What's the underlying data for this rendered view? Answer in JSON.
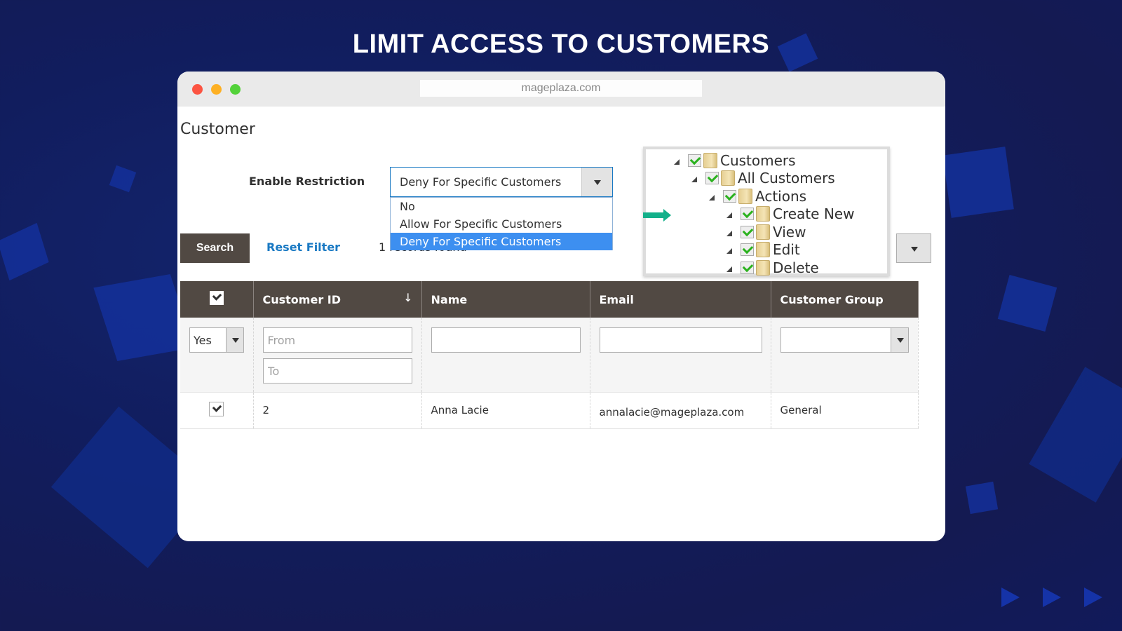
{
  "headline": "LIMIT ACCESS TO CUSTOMERS",
  "browser": {
    "url": "mageplaza.com"
  },
  "page": {
    "title": "Customer"
  },
  "restriction": {
    "label": "Enable Restriction",
    "selected": "Deny For Specific Customers",
    "options": [
      "No",
      "Allow For Specific Customers",
      "Deny For Specific Customers"
    ]
  },
  "toolbar": {
    "search_label": "Search",
    "reset_label": "Reset Filter",
    "records_text": "1 records found"
  },
  "tree": {
    "nodes": [
      {
        "label": "Customers",
        "level": 0,
        "checked": true
      },
      {
        "label": "All Customers",
        "level": 1,
        "checked": true
      },
      {
        "label": "Actions",
        "level": 2,
        "checked": true
      },
      {
        "label": "Create New",
        "level": 3,
        "checked": true
      },
      {
        "label": "View",
        "level": 3,
        "checked": true
      },
      {
        "label": "Edit",
        "level": 3,
        "checked": true
      },
      {
        "label": "Delete",
        "level": 3,
        "checked": true
      }
    ]
  },
  "grid": {
    "columns": [
      "Customer ID",
      "Name",
      "Email",
      "Customer Group"
    ],
    "filters": {
      "in_selection": "Yes",
      "id_from_placeholder": "From",
      "id_to_placeholder": "To",
      "name_value": "",
      "email_value": "",
      "group_value": ""
    },
    "rows": [
      {
        "checked": true,
        "id": "2",
        "name": "Anna Lacie",
        "email": "annalacie@mageplaza.com",
        "group": "General"
      }
    ]
  },
  "colors": {
    "accent_blue": "#1979c3",
    "header_brown": "#514943",
    "arrow_green": "#13b08a",
    "selected_option": "#3d8ff0"
  }
}
